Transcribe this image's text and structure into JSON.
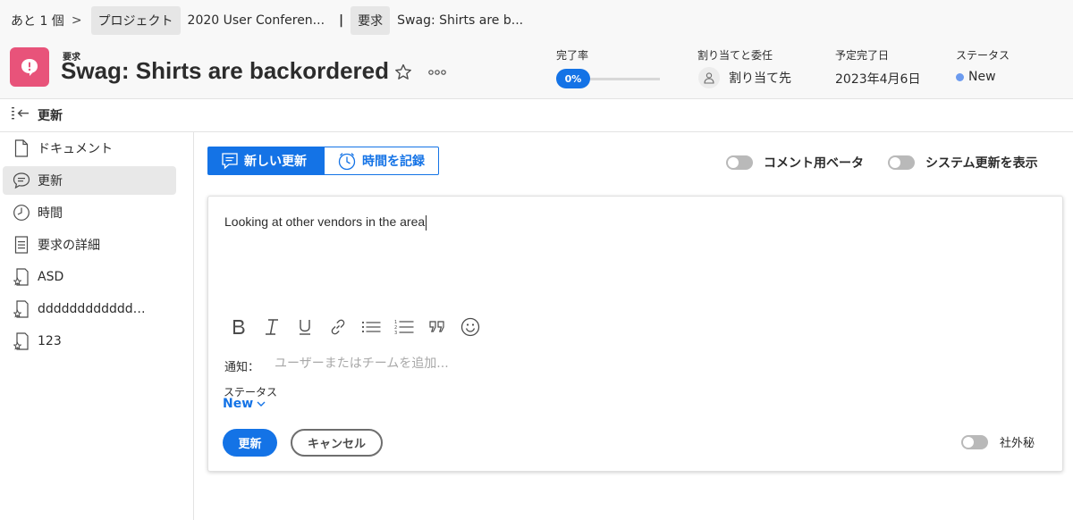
{
  "breadcrumb": {
    "more": "あと 1 個",
    "sep": ">",
    "project_type": "プロジェクト",
    "project_name": "2020 User Conferen...",
    "divider": "|",
    "request_type": "要求",
    "request_name": "Swag: Shirts are b..."
  },
  "header": {
    "object_type": "要求",
    "title": "Swag: Shirts are backordered",
    "percent_complete_label": "完了率",
    "percent_complete_value": "0%",
    "percent_complete": 0,
    "assign_label": "割り当てと委任",
    "assign_value": "割り当て先",
    "due_label": "予定完了日",
    "due_value": "2023年4月6日",
    "status_label": "ステータス",
    "status_value": "New",
    "status_color": "#6c9bef"
  },
  "section": {
    "title": "更新"
  },
  "leftnav": {
    "items": [
      {
        "label": "ドキュメント",
        "icon": "document-icon"
      },
      {
        "label": "更新",
        "icon": "comment-icon",
        "active": true
      },
      {
        "label": "時間",
        "icon": "clock-icon"
      },
      {
        "label": "要求の詳細",
        "icon": "details-icon"
      },
      {
        "label": "ASD",
        "icon": "custom-form-icon"
      },
      {
        "label": "dddddddddddddd…",
        "icon": "custom-form-icon"
      },
      {
        "label": "123",
        "icon": "custom-form-icon"
      }
    ]
  },
  "main": {
    "new_update_label": "新しい更新",
    "log_time_label": "時間を記録",
    "comment_beta_label": "コメント用ベータ",
    "show_system_updates_label": "システム更新を表示",
    "editor_text": "Looking at other vendors in the area",
    "notify_label": "通知：",
    "notify_placeholder": "ユーザーまたはチームを追加...",
    "status_label": "ステータス",
    "status_value": "New",
    "update_button": "更新",
    "cancel_button": "キャンセル",
    "private_label": "社外秘"
  },
  "colors": {
    "accent": "#1473e6",
    "request_icon_bg": "#e8537a"
  }
}
